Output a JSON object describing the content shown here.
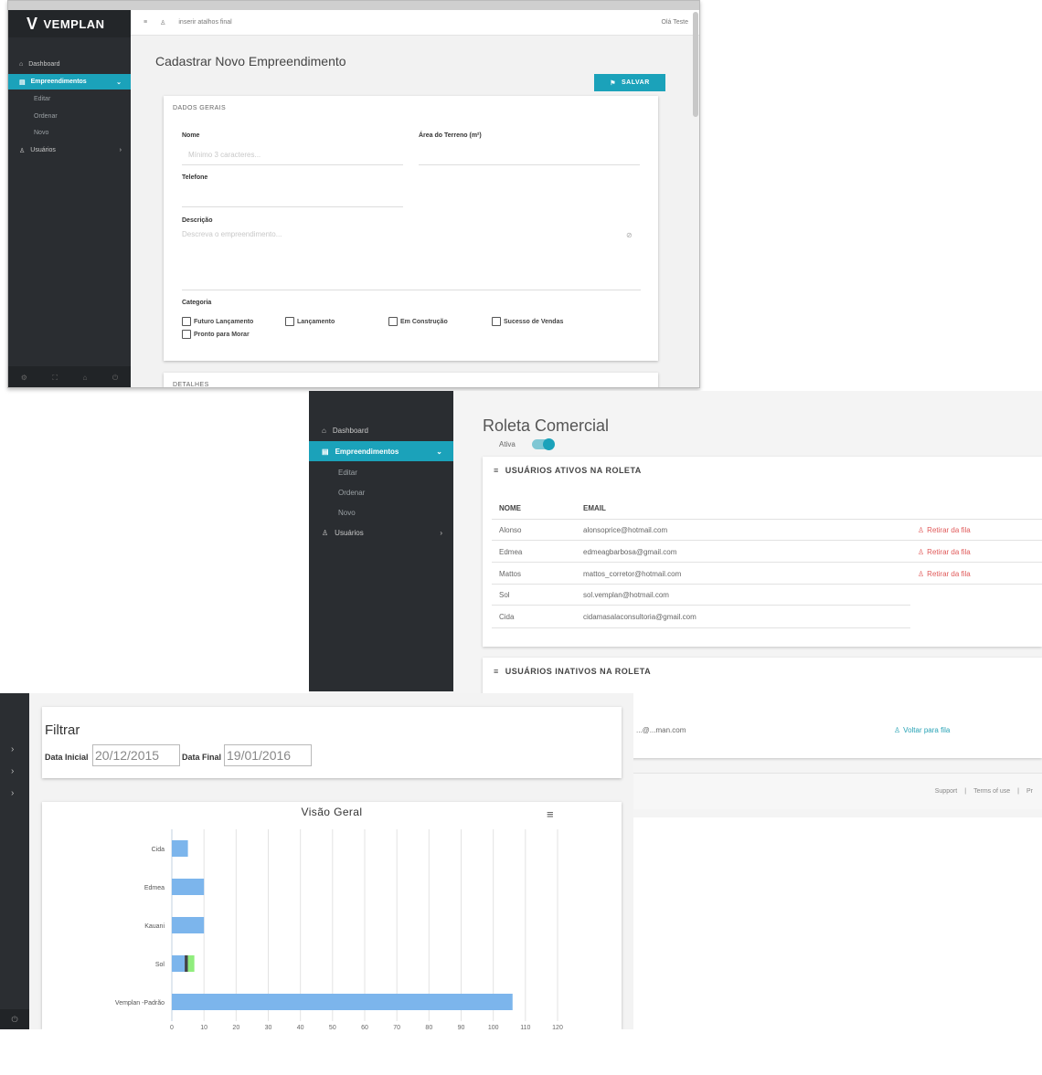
{
  "screen1": {
    "brand": "VEMPLAN",
    "header": {
      "shortcut_text": "inserir atalhos final",
      "user": "Olá Teste"
    },
    "sidebar": {
      "items": [
        {
          "label": "Dashboard"
        },
        {
          "label": "Empreendimentos",
          "active": true
        },
        {
          "label": "Editar"
        },
        {
          "label": "Ordenar"
        },
        {
          "label": "Novo"
        },
        {
          "label": "Usuários"
        }
      ]
    },
    "page_title": "Cadastrar Novo Empreendimento",
    "save_label": "SALVAR",
    "form": {
      "section_title": "DADOS GERAIS",
      "nome_label": "Nome",
      "nome_placeholder": "Mínimo 3 caracteres...",
      "area_label": "Área do Terreno (m²)",
      "telefone_label": "Telefone",
      "descricao_label": "Descrição",
      "descricao_placeholder": "Descreva o empreendimento...",
      "categoria_label": "Categoria",
      "categorias": [
        "Futuro Lançamento",
        "Lançamento",
        "Em Construção",
        "Sucesso de Vendas",
        "Pronto para Morar"
      ],
      "next_section": "DETALHES"
    },
    "accent_color": "#1ba2ba"
  },
  "screen2": {
    "sidebar": {
      "items": [
        {
          "label": "Dashboard"
        },
        {
          "label": "Empreendimentos",
          "active": true
        },
        {
          "label": "Editar"
        },
        {
          "label": "Ordenar"
        },
        {
          "label": "Novo"
        },
        {
          "label": "Usuários"
        }
      ]
    },
    "page_title": "Roleta Comercial",
    "toggle_label": "Ativa",
    "toggle_on": true,
    "active_card_title": "USUÁRIOS ATIVOS NA ROLETA",
    "columns": [
      "NOME",
      "EMAIL"
    ],
    "active_users": [
      {
        "name": "Alonso",
        "email": "alonsoprice@hotmail.com",
        "action": "Retirar da fila"
      },
      {
        "name": "Edmea",
        "email": "edmeagbarbosa@gmail.com",
        "action": "Retirar da fila"
      },
      {
        "name": "Mattos",
        "email": "mattos_corretor@hotmail.com",
        "action": "Retirar da fila"
      },
      {
        "name": "Sol",
        "email": "sol.vemplan@hotmail.com",
        "action": ""
      },
      {
        "name": "Cida",
        "email": "cidamasalaconsultoria@gmail.com",
        "action": ""
      }
    ],
    "inactive_card_title": "USUÁRIOS INATIVOS NA ROLETA",
    "inactive_users": [
      {
        "email": "...@...man.com",
        "action": "Voltar para fila"
      }
    ],
    "footer_links": [
      "Support",
      "|",
      "Terms of use",
      "|",
      "Pr"
    ]
  },
  "screen3": {
    "filter": {
      "title": "Filtrar",
      "start_label": "Data Inicial",
      "start_value": "20/12/2015",
      "end_label": "Data Final",
      "end_value": "19/01/2016"
    },
    "chart_title": "Visão Geral",
    "chart_data": {
      "type": "bar",
      "orientation": "horizontal",
      "stacked": true,
      "title": "Visão Geral",
      "categories": [
        "Cida",
        "Edmea",
        "Kauani",
        "Sol",
        "Vemplan -Padrão"
      ],
      "series": [
        {
          "color": "#7cb5ec",
          "values": [
            5,
            10,
            10,
            4,
            106
          ]
        },
        {
          "color": "#434348",
          "values": [
            0,
            0,
            0,
            1,
            0
          ]
        },
        {
          "color": "#90ed7d",
          "values": [
            0,
            0,
            0,
            2,
            0
          ]
        }
      ],
      "xlim": [
        0,
        120
      ],
      "ticks": [
        0,
        10,
        20,
        30,
        40,
        50,
        60,
        70,
        80,
        90,
        100,
        110,
        120
      ],
      "grid": true,
      "legend": "none"
    }
  }
}
